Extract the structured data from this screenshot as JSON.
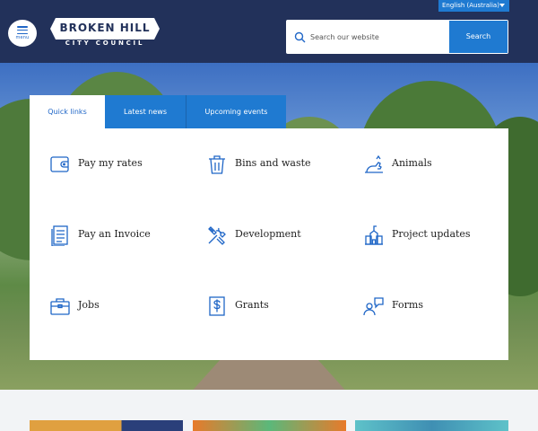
{
  "header": {
    "language": "English (Australia)",
    "menu_label": "menu",
    "logo_title": "BROKEN HILL",
    "logo_subtitle": "CITY COUNCIL",
    "search_placeholder": "Search our website",
    "search_button": "Search"
  },
  "tabs": [
    {
      "label": "Quick links",
      "active": true
    },
    {
      "label": "Latest news",
      "active": false
    },
    {
      "label": "Upcoming events",
      "active": false
    }
  ],
  "quick_links": [
    {
      "label": "Pay my rates",
      "icon": "wallet-icon"
    },
    {
      "label": "Bins and waste",
      "icon": "bin-icon"
    },
    {
      "label": "Animals",
      "icon": "dog-icon"
    },
    {
      "label": "Pay an Invoice",
      "icon": "invoice-icon"
    },
    {
      "label": "Development",
      "icon": "tools-icon"
    },
    {
      "label": "Project updates",
      "icon": "building-icon"
    },
    {
      "label": "Jobs",
      "icon": "briefcase-icon"
    },
    {
      "label": "Grants",
      "icon": "dollar-icon"
    },
    {
      "label": "Forms",
      "icon": "person-chat-icon"
    }
  ],
  "colors": {
    "header_bg": "#22315a",
    "accent": "#1f7ad1",
    "icon": "#1f66c7"
  }
}
